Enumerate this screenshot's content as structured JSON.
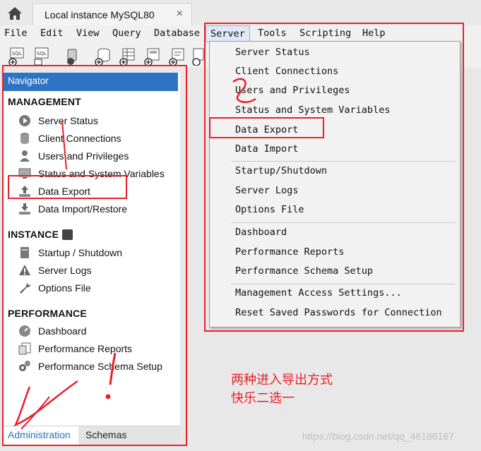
{
  "tab": {
    "title": "Local instance MySQL80",
    "close": "×"
  },
  "menubar": [
    "File",
    "Edit",
    "View",
    "Query",
    "Database",
    "Server",
    "Tools",
    "Scripting",
    "Help"
  ],
  "active_menu": "Server",
  "toolbar_icon_labels": {
    "sql1": "SQL",
    "sql2": "SQL"
  },
  "navigator": {
    "header": "Navigator",
    "management": {
      "title": "MANAGEMENT",
      "items": [
        "Server Status",
        "Client Connections",
        "Users and Privileges",
        "Status and System Variables",
        "Data Export",
        "Data Import/Restore"
      ]
    },
    "instance": {
      "title": "INSTANCE",
      "items": [
        "Startup / Shutdown",
        "Server Logs",
        "Options File"
      ]
    },
    "performance": {
      "title": "PERFORMANCE",
      "items": [
        "Dashboard",
        "Performance Reports",
        "Performance Schema Setup"
      ]
    },
    "bottom_tabs": [
      "Administration",
      "Schemas"
    ]
  },
  "server_menu": {
    "items": [
      "Server Status",
      "Client Connections",
      "Users and Privileges",
      "Status and System Variables",
      "Data Export",
      "Data Import",
      "Startup/Shutdown",
      "Server Logs",
      "Options File",
      "Dashboard",
      "Performance Reports",
      "Performance Schema Setup",
      "Management Access Settings...",
      "Reset Saved Passwords for Connection"
    ]
  },
  "annotation": {
    "line1": "两种进入导出方式",
    "line2": "快乐二选一",
    "color": "#e8202a"
  },
  "watermark": "https://blog.csdn.net/qq_46186167",
  "colors": {
    "navigator_header": "#2f73c4",
    "active_tab_text": "#2a6fbf",
    "annotation": "#e8202a"
  }
}
